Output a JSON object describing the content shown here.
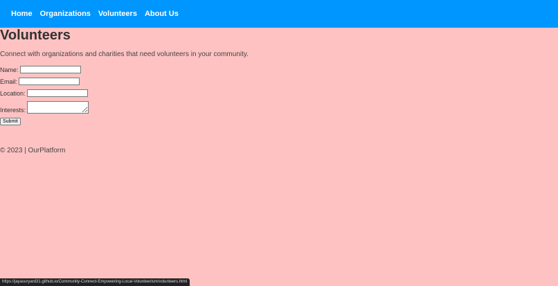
{
  "nav": {
    "items": [
      "Home",
      "Organizations",
      "Volunteers",
      "About Us"
    ]
  },
  "page": {
    "title": "Volunteers",
    "intro": "Connect with organizations and charities that need volunteers in your community."
  },
  "form": {
    "name_label": "Name:",
    "name_value": "",
    "email_label": "Email:",
    "email_value": "",
    "location_label": "Location:",
    "location_value": "",
    "interests_label": "Interests:",
    "interests_value": "",
    "submit_label": "Submit"
  },
  "footer": {
    "text": "© 2023 | OurPlatform"
  },
  "status_bar": {
    "url": "https://jayasuryard31.github.io/Community-Connect-Empowering-Local-Volunteerism/volunteers.html"
  },
  "colors": {
    "nav_bg": "#0096ff",
    "page_bg": "#ffc2c2"
  }
}
